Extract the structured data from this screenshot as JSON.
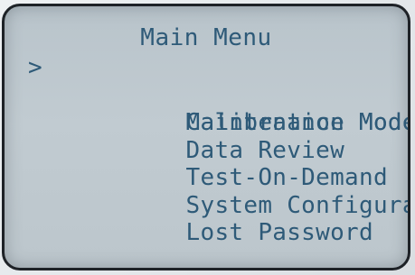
{
  "screen": {
    "title": "Main Menu",
    "cursor_symbol": ">",
    "selected_index": 0,
    "items": [
      {
        "label": "Calibration Mode"
      },
      {
        "label": "Maintenance Mode"
      },
      {
        "label": "Data Review"
      },
      {
        "label": "Test-On-Demand"
      },
      {
        "label": "System Configuration"
      },
      {
        "label": "Lost Password"
      }
    ]
  },
  "colors": {
    "lcd_text": "#2e5a78",
    "lcd_background": "#bdc7cd",
    "frame": "#1e2227"
  }
}
